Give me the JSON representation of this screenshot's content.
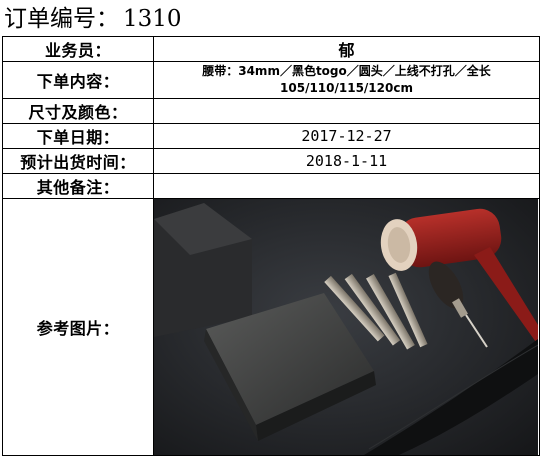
{
  "title": {
    "label": "订单编号：",
    "order_number": "1310"
  },
  "rows": {
    "salesperson": {
      "label": "业务员：",
      "value": "郁"
    },
    "content": {
      "label": "下单内容：",
      "value": "腰带：34mm／黑色togo／圆头／上线不打孔／全长105/110/115/120cm"
    },
    "size_color": {
      "label": "尺寸及颜色：",
      "value": ""
    },
    "order_date": {
      "label": "下单日期：",
      "value": "2017-12-27"
    },
    "ship_date": {
      "label": "预计出货时间：",
      "value": "2018-1-11"
    },
    "remarks": {
      "label": "其他备注：",
      "value": ""
    },
    "reference": {
      "label": "参考图片："
    }
  },
  "photo": {
    "icon": "leather-tools-photo",
    "colors": {
      "background": "#1f2124",
      "mallet_head": "#9c1e1c",
      "mallet_face": "#e8d6c2",
      "stamp_block": "#3a3b3b",
      "belt": "#121314",
      "tool_shaft": "#b9b0a2"
    }
  }
}
